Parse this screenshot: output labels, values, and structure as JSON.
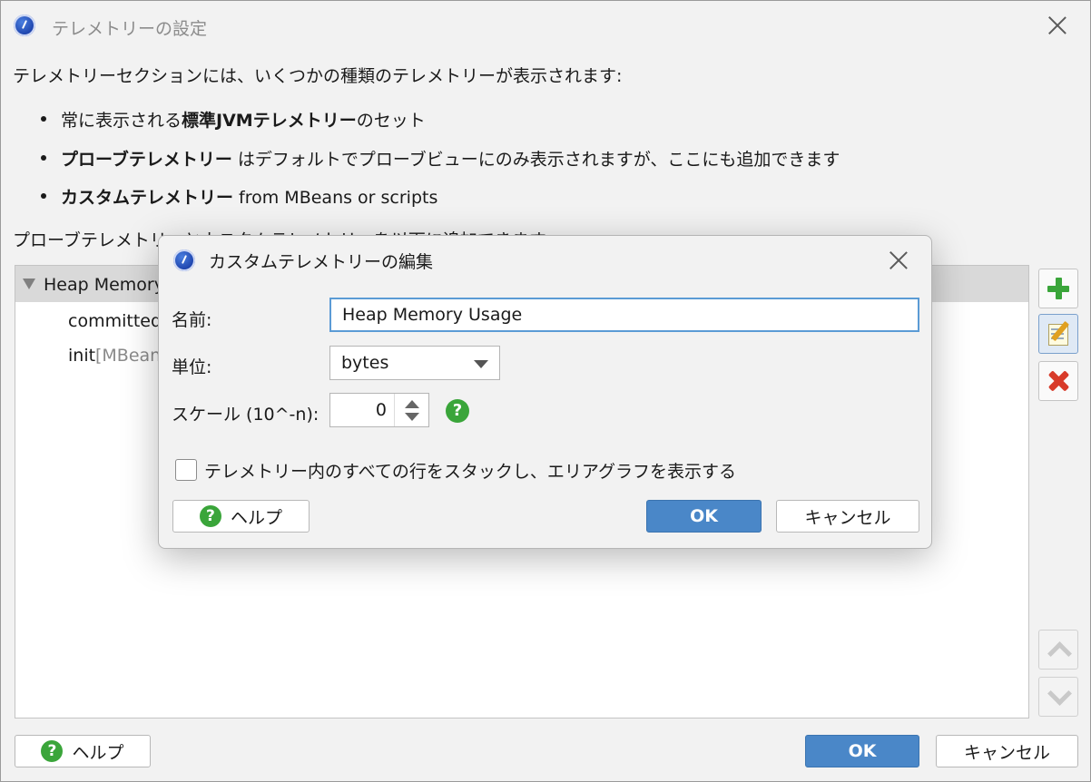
{
  "window": {
    "title": "テレメトリーの設定",
    "intro": "テレメトリーセクションには、いくつかの種類のテレメトリーが表示されます:",
    "bullets": [
      {
        "pre": "常に表示される",
        "bold": "標準JVMテレメトリー",
        "post": "のセット"
      },
      {
        "pre": "",
        "bold": "プローブテレメトリー",
        "post": " はデフォルトでプローブビューにのみ表示されますが、ここにも追加できます"
      },
      {
        "pre": "",
        "bold": "カスタムテレメトリー",
        "post": " from MBeans or scripts"
      }
    ],
    "desc2": "プローブテレメトリーとカスタムテレメトリーを以下に追加できます。",
    "tree": [
      {
        "label": "Heap Memory",
        "extra": ""
      },
      {
        "label": "committed",
        "extra": ""
      },
      {
        "label": "init",
        "extra": " [MBean"
      }
    ],
    "help_label": "ヘルプ",
    "ok_label": "OK",
    "cancel_label": "キャンセル",
    "icons": {
      "app": "app-icon",
      "add": "add-icon",
      "edit": "edit-icon",
      "delete": "delete-icon",
      "up": "move-up-icon",
      "down": "move-down-icon"
    }
  },
  "dialog": {
    "title": "カスタムテレメトリーの編集",
    "name_label": "名前:",
    "name_value": "Heap Memory Usage",
    "unit_label": "単位:",
    "unit_value": "bytes",
    "scale_label": "スケール (10^-n):",
    "scale_value": "0",
    "stack_label": "テレメトリー内のすべての行をスタックし、エリアグラフを表示する",
    "stack_checked": false,
    "help_label": "ヘルプ",
    "ok_label": "OK",
    "cancel_label": "キャンセル"
  },
  "colors": {
    "accent": "#4a87c8",
    "help_green": "#3aa53a",
    "delete_red": "#d83b2a"
  }
}
